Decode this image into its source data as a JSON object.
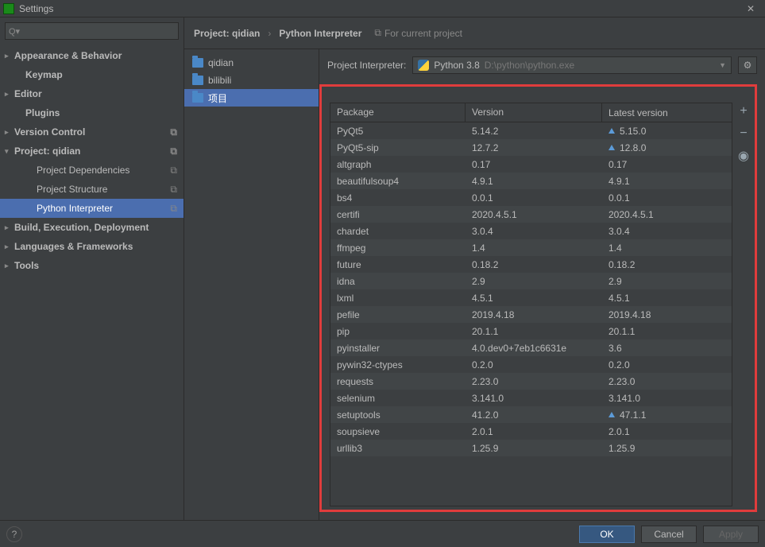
{
  "window": {
    "title": "Settings"
  },
  "sidebar": {
    "items": [
      {
        "label": "Appearance & Behavior",
        "expandable": true,
        "bold": true
      },
      {
        "label": "Keymap",
        "bold": true,
        "level": 1
      },
      {
        "label": "Editor",
        "expandable": true,
        "bold": true
      },
      {
        "label": "Plugins",
        "bold": true,
        "level": 1
      },
      {
        "label": "Version Control",
        "expandable": true,
        "bold": true,
        "tail": "copy"
      },
      {
        "label": "Project: qidian",
        "expandable": true,
        "expanded": true,
        "bold": true,
        "tail": "copy"
      },
      {
        "label": "Project Dependencies",
        "level": 2,
        "tail": "copy"
      },
      {
        "label": "Project Structure",
        "level": 2,
        "tail": "copy"
      },
      {
        "label": "Python Interpreter",
        "level": 2,
        "tail": "copy",
        "selected": true
      },
      {
        "label": "Build, Execution, Deployment",
        "expandable": true,
        "bold": true
      },
      {
        "label": "Languages & Frameworks",
        "expandable": true,
        "bold": true
      },
      {
        "label": "Tools",
        "expandable": true,
        "bold": true
      }
    ]
  },
  "breadcrumb": {
    "item1": "Project: qidian",
    "item2": "Python Interpreter",
    "tag": "For current project"
  },
  "projects": [
    {
      "label": "qidian"
    },
    {
      "label": "bilibili"
    },
    {
      "label": "项目",
      "selected": true
    }
  ],
  "interpreter": {
    "label": "Project Interpreter:",
    "name": "Python 3.8",
    "path": "D:\\python\\python.exe"
  },
  "packages": {
    "headers": {
      "package": "Package",
      "version": "Version",
      "latest": "Latest version"
    },
    "rows": [
      {
        "pkg": "PyQt5",
        "ver": "5.14.2",
        "lat": "5.15.0",
        "update": true
      },
      {
        "pkg": "PyQt5-sip",
        "ver": "12.7.2",
        "lat": "12.8.0",
        "update": true
      },
      {
        "pkg": "altgraph",
        "ver": "0.17",
        "lat": "0.17"
      },
      {
        "pkg": "beautifulsoup4",
        "ver": "4.9.1",
        "lat": "4.9.1"
      },
      {
        "pkg": "bs4",
        "ver": "0.0.1",
        "lat": "0.0.1"
      },
      {
        "pkg": "certifi",
        "ver": "2020.4.5.1",
        "lat": "2020.4.5.1"
      },
      {
        "pkg": "chardet",
        "ver": "3.0.4",
        "lat": "3.0.4"
      },
      {
        "pkg": "ffmpeg",
        "ver": "1.4",
        "lat": "1.4"
      },
      {
        "pkg": "future",
        "ver": "0.18.2",
        "lat": "0.18.2"
      },
      {
        "pkg": "idna",
        "ver": "2.9",
        "lat": "2.9"
      },
      {
        "pkg": "lxml",
        "ver": "4.5.1",
        "lat": "4.5.1"
      },
      {
        "pkg": "pefile",
        "ver": "2019.4.18",
        "lat": "2019.4.18"
      },
      {
        "pkg": "pip",
        "ver": "20.1.1",
        "lat": "20.1.1"
      },
      {
        "pkg": "pyinstaller",
        "ver": "4.0.dev0+7eb1c6631e",
        "lat": "3.6"
      },
      {
        "pkg": "pywin32-ctypes",
        "ver": "0.2.0",
        "lat": "0.2.0"
      },
      {
        "pkg": "requests",
        "ver": "2.23.0",
        "lat": "2.23.0"
      },
      {
        "pkg": "selenium",
        "ver": "3.141.0",
        "lat": "3.141.0"
      },
      {
        "pkg": "setuptools",
        "ver": "41.2.0",
        "lat": "47.1.1",
        "update": true
      },
      {
        "pkg": "soupsieve",
        "ver": "2.0.1",
        "lat": "2.0.1"
      },
      {
        "pkg": "urllib3",
        "ver": "1.25.9",
        "lat": "1.25.9"
      }
    ]
  },
  "footer": {
    "ok": "OK",
    "cancel": "Cancel",
    "apply": "Apply"
  }
}
